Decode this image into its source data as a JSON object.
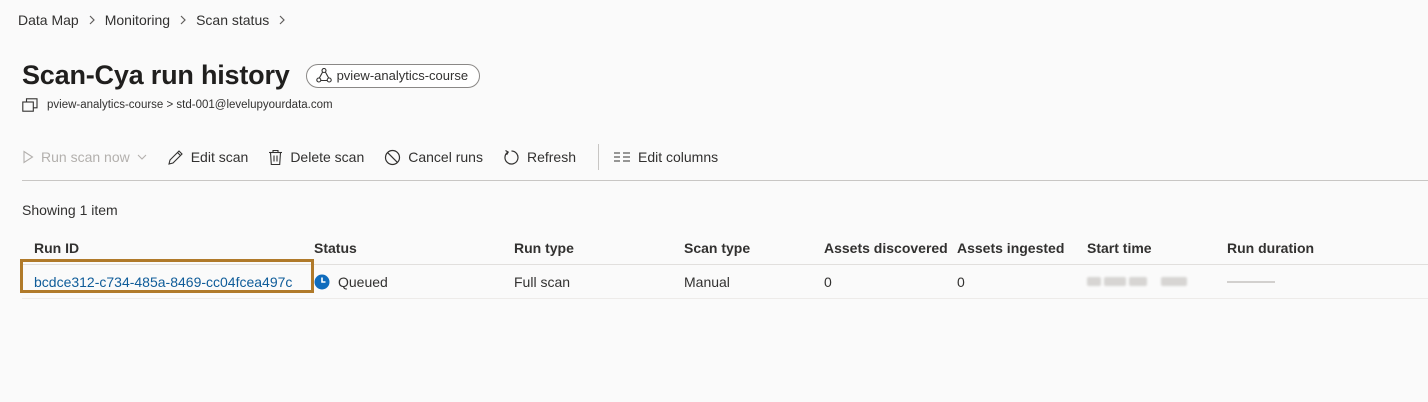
{
  "breadcrumb": [
    "Data Map",
    "Monitoring",
    "Scan status"
  ],
  "page": {
    "title": "Scan-Cya run history",
    "collection": "pview-analytics-course",
    "path": "pview-analytics-course > std-001@levelupyourdata.com"
  },
  "toolbar": {
    "run_scan": "Run scan now",
    "edit_scan": "Edit scan",
    "delete_scan": "Delete scan",
    "cancel_runs": "Cancel runs",
    "refresh": "Refresh",
    "edit_columns": "Edit columns"
  },
  "count_text": "Showing 1 item",
  "table": {
    "columns": [
      "Run ID",
      "Status",
      "Run type",
      "Scan type",
      "Assets discovered",
      "Assets ingested",
      "Start time",
      "Run duration"
    ],
    "rows": [
      {
        "run_id": "bcdce312-c734-485a-8469-cc04fcea497c",
        "status": "Queued",
        "run_type": "Full scan",
        "scan_type": "Manual",
        "assets_discovered": "0",
        "assets_ingested": "0"
      }
    ]
  },
  "colors": {
    "link": "#0f5c99",
    "status_icon": "#0f6cbd",
    "highlight": "#b07a2a"
  },
  "icons": [
    "chevron-right-icon",
    "collection-icon",
    "copy-path-icon",
    "play-icon",
    "chevron-down-icon",
    "pencil-icon",
    "trash-icon",
    "cancel-icon",
    "refresh-icon",
    "columns-icon",
    "clock-icon"
  ]
}
